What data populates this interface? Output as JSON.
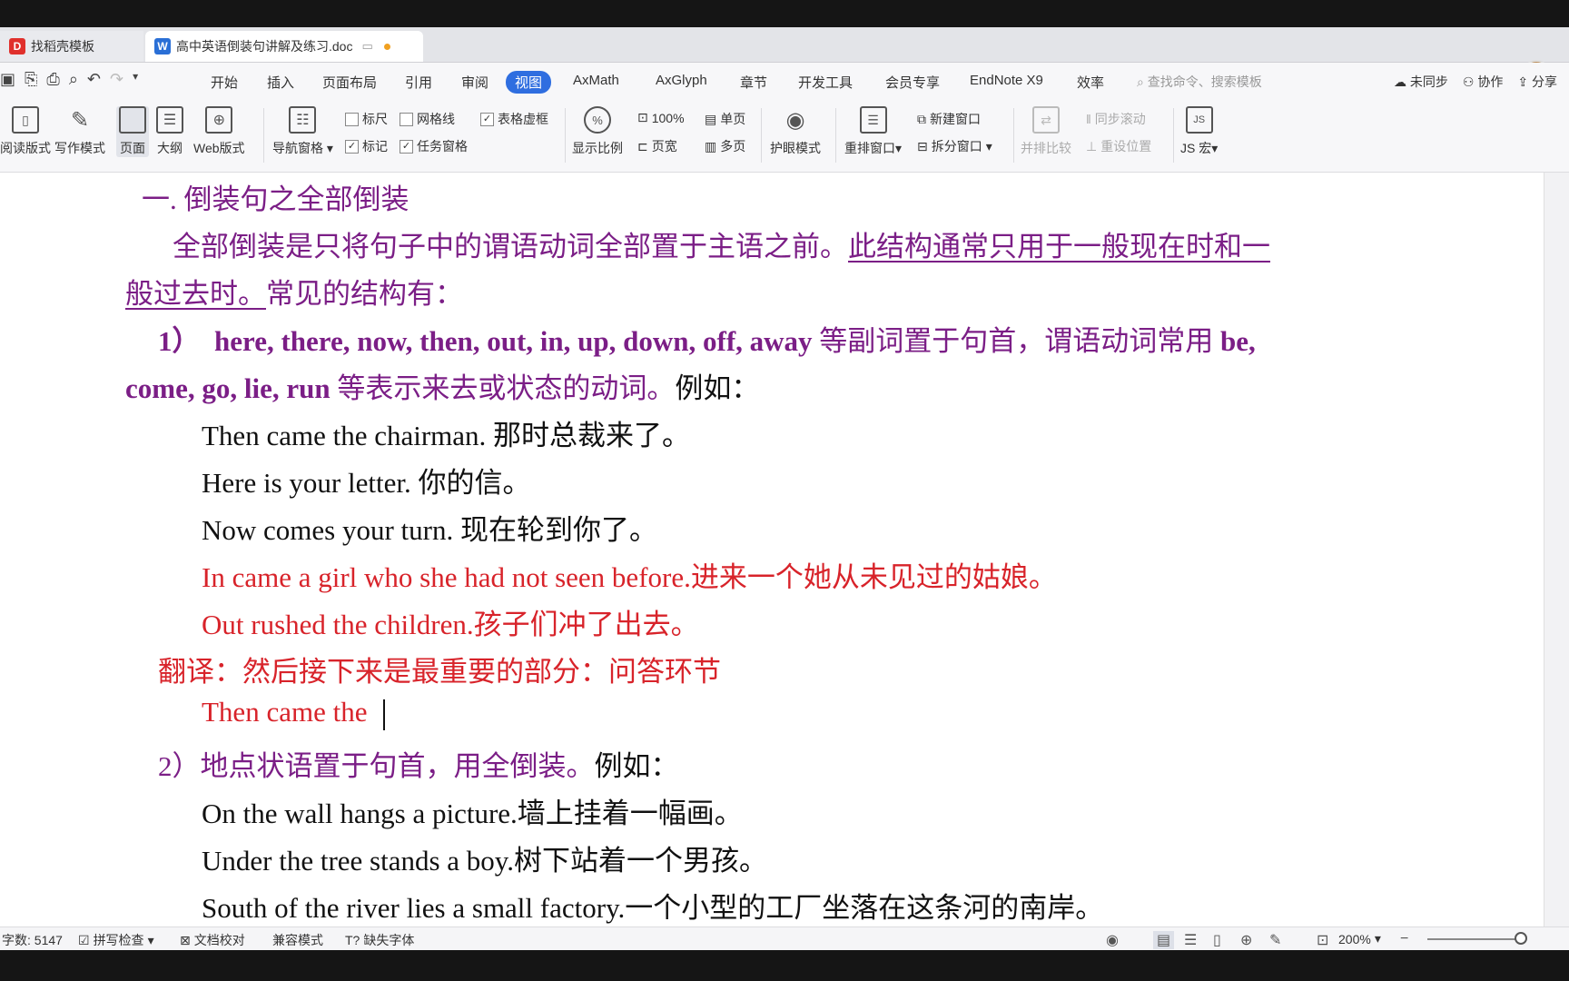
{
  "tabs": {
    "tab1_label": "找稻壳模板",
    "tab2_label": "高中英语倒装句讲解及练习.doc"
  },
  "menus": [
    "开始",
    "插入",
    "页面布局",
    "引用",
    "审阅",
    "视图",
    "AxMath",
    "AxGlyph",
    "章节",
    "开发工具",
    "会员专享",
    "EndNote X9",
    "效率"
  ],
  "active_menu": "视图",
  "search_placeholder": "查找命令、搜索模板",
  "menu_right": {
    "sync": "未同步",
    "collab": "协作",
    "share": "分享"
  },
  "ribbon": {
    "read_mode": "阅读版式",
    "write_mode": "写作模式",
    "page": "页面",
    "outline": "大纲",
    "web": "Web版式",
    "nav_pane": "导航窗格",
    "ruler": "标尺",
    "gridlines": "网格线",
    "table_gridlines": "表格虚框",
    "marks": "标记",
    "task_pane": "任务窗格",
    "zoom_ratio": "显示比例",
    "zoom_100": "100%",
    "single_page": "单页",
    "page_width": "页宽",
    "multi_page": "多页",
    "eye_mode": "护眼模式",
    "arrange": "重排窗口",
    "new_window": "新建窗口",
    "split_window": "拆分窗口",
    "side_by_side": "并排比较",
    "sync_scroll": "同步滚动",
    "reset_position": "重设位置",
    "js_macro": "JS 宏"
  },
  "document": {
    "heading": "一.    倒装句之全部倒装",
    "intro_part1": "全部倒装是只将句子中的谓语动词全部置于主语之前。",
    "intro_part2": "此结构通常只用于一般现在时和一",
    "intro_part3": "般过去时。",
    "intro_part4": "常见的结构有：",
    "rule1_num": "1）",
    "rule1_words": "here, there, now, then, out, in, up, down, off, away",
    "rule1_text": "等副词置于句首，谓语动词常用",
    "rule1_be": "be,",
    "rule1_words2": "come, go, lie, run",
    "rule1_text2": "等表示来去或状态的动词。",
    "rule1_eg": "例如：",
    "ex1": "Then came the chairman.  那时总裁来了。",
    "ex2": "Here is your letter.  你的信。",
    "ex3": "Now comes your turn.  现在轮到你了。",
    "ex4": "In came a girl who she had not seen before.进来一个她从未见过的姑娘。",
    "ex5": "Out rushed the children.孩子们冲了出去。",
    "translate": "翻译：然后接下来是最重要的部分：问答环节",
    "typing": "Then came the",
    "rule2_main": "2）地点状语置于句首，用全倒装。",
    "rule2_eg": "例如：",
    "ex6": "On the wall hangs a picture.墙上挂着一幅画。",
    "ex7": "Under the tree stands a boy.树下站着一个男孩。",
    "ex8": "South of the river lies a small factory.一个小型的工厂坐落在这条河的南岸。"
  },
  "status": {
    "word_count": "字数: 5147",
    "spell_check": "拼写检查",
    "doc_check": "文档校对",
    "compat_mode": "兼容模式",
    "missing_font": "缺失字体",
    "zoom": "200%"
  }
}
